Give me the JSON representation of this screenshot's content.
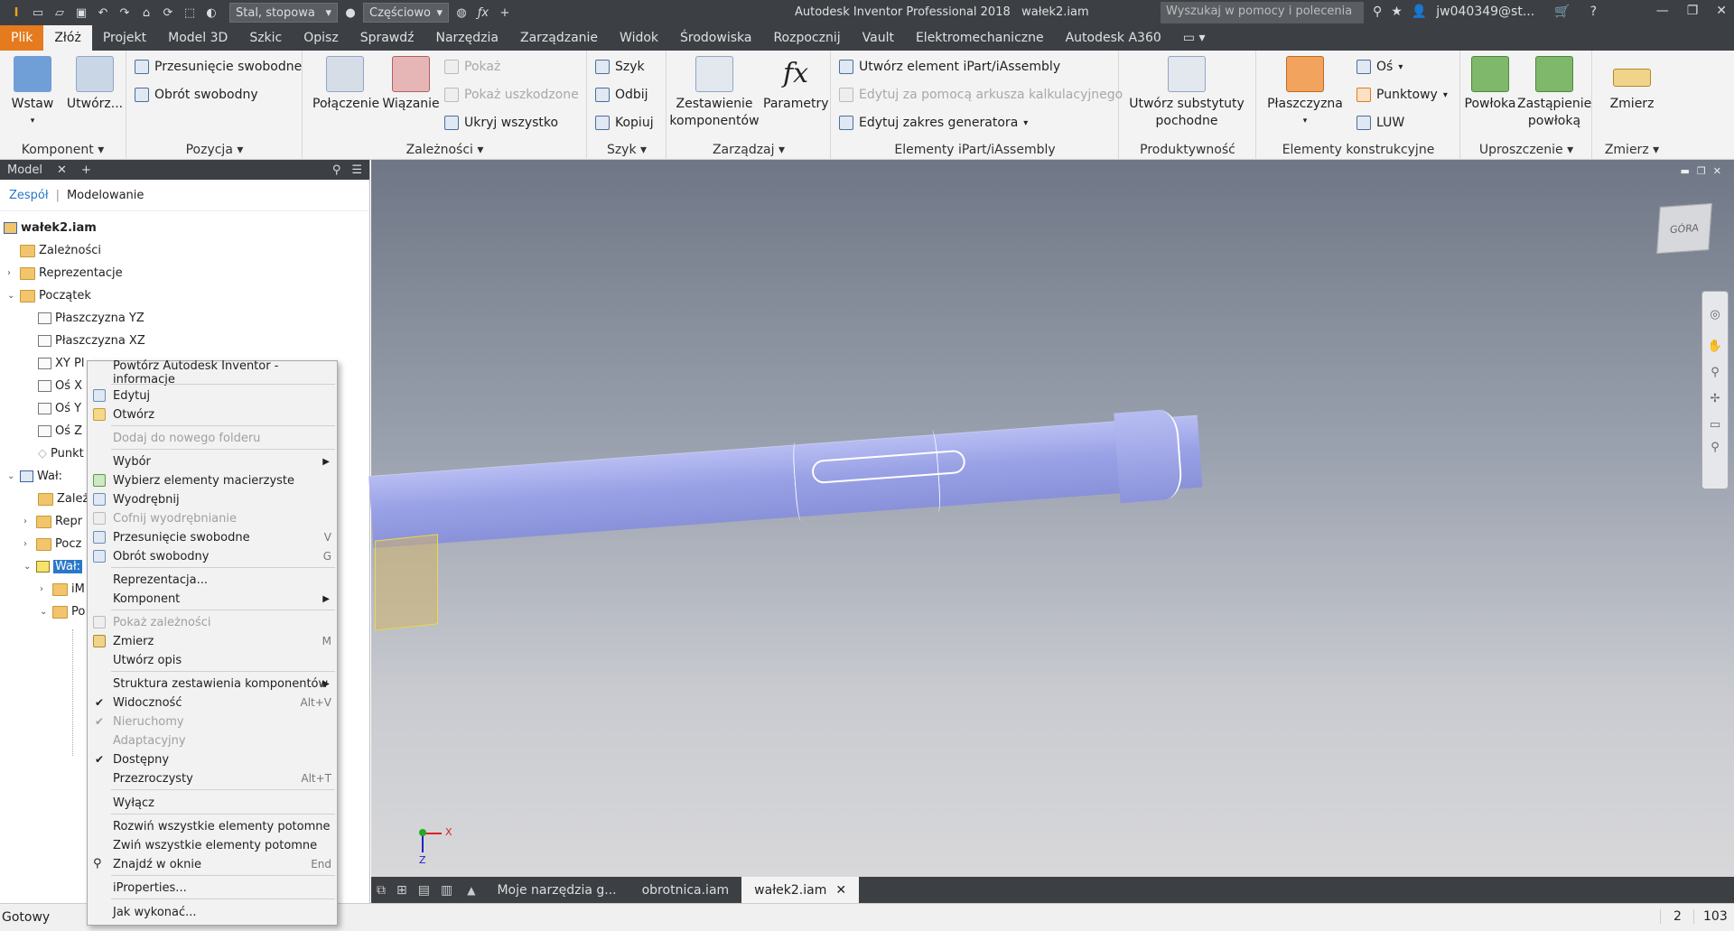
{
  "titlebar": {
    "material": "Stal, stopowa",
    "appearance": "Częściowo",
    "app_title": "Autodesk Inventor Professional 2018",
    "doc_title": "wałek2.iam",
    "search_placeholder": "Wyszukaj w pomocy i polecenia",
    "user": "jw040349@st..."
  },
  "menu": {
    "tabs": [
      "Plik",
      "Złóż",
      "Projekt",
      "Model 3D",
      "Szkic",
      "Opisz",
      "Sprawdź",
      "Narzędzia",
      "Zarządzanie",
      "Widok",
      "Środowiska",
      "Rozpocznij",
      "Vault",
      "Elektromechaniczne",
      "Autodesk A360"
    ]
  },
  "ribbon": {
    "komponent": {
      "title": "Komponent",
      "wstaw": "Wstaw",
      "utworz": "Utwórz..."
    },
    "pozycja": {
      "title": "Pozycja",
      "przesuniecie": "Przesunięcie swobodne",
      "obrot": "Obrót swobodny"
    },
    "zaleznosci": {
      "title": "Zależności",
      "polaczenie": "Połączenie",
      "wiazanie": "Wiązanie",
      "pokaz": "Pokaż",
      "pokaz_uszk": "Pokaż uszkodzone",
      "ukryj": "Ukryj wszystko"
    },
    "szyk": {
      "title": "Szyk",
      "szyk": "Szyk",
      "odbij": "Odbij",
      "kopiuj": "Kopiuj"
    },
    "zarzadzaj": {
      "title": "Zarządzaj",
      "zestawienie": "Zestawienie komponentów",
      "parametry": "Parametry"
    },
    "ipart": {
      "title": "Elementy iPart/iAssembly",
      "utworz": "Utwórz element iPart/iAssembly",
      "edytuj": "Edytuj za pomocą arkusza kalkulacyjnego",
      "zakres": "Edytuj zakres generatora"
    },
    "produktywnosc": {
      "title": "Produktywność",
      "substytut": "Utwórz substytuty pochodne"
    },
    "konstrukcyjne": {
      "title": "Elementy konstrukcyjne",
      "plaszczyzna": "Płaszczyzna",
      "os": "Oś",
      "punktowy": "Punktowy",
      "luw": "LUW"
    },
    "uproszczenie": {
      "title": "Uproszczenie",
      "powloka": "Powłoka",
      "zastapienie": "Zastąpienie powłoką"
    },
    "zmierz": {
      "title": "Zmierz",
      "zmierz": "Zmierz"
    }
  },
  "browser": {
    "header": "Model",
    "sub_tab1": "Zespół",
    "sub_tab2": "Modelowanie",
    "nodes": [
      "wałek2.iam",
      "Zależności",
      "Reprezentacje",
      "Początek",
      "Płaszczyzna YZ",
      "Płaszczyzna XZ",
      "XY Pl",
      "Oś X",
      "Oś Y",
      "Oś Z",
      "Punkt",
      "Wał:",
      "Zależ",
      "Repr",
      "Pocz",
      "Wał:",
      "iM",
      "Po"
    ]
  },
  "context_menu": {
    "items": [
      {
        "label": "Powtórz Autodesk Inventor - informacje"
      },
      {
        "label": "Edytuj"
      },
      {
        "label": "Otwórz"
      },
      {
        "label": "Dodaj do nowego folderu"
      },
      {
        "label": "Wybór"
      },
      {
        "label": "Wybierz elementy macierzyste"
      },
      {
        "label": "Wyodrębnij"
      },
      {
        "label": "Cofnij wyodrębnianie"
      },
      {
        "label": "Przesunięcie swobodne",
        "shortcut": "V"
      },
      {
        "label": "Obrót swobodny",
        "shortcut": "G"
      },
      {
        "label": "Reprezentacja..."
      },
      {
        "label": "Komponent"
      },
      {
        "label": "Pokaż zależności"
      },
      {
        "label": "Zmierz",
        "shortcut": "M"
      },
      {
        "label": "Utwórz opis"
      },
      {
        "label": "Struktura zestawienia komponentów"
      },
      {
        "label": "Widoczność",
        "shortcut": "Alt+V"
      },
      {
        "label": "Nieruchomy"
      },
      {
        "label": "Adaptacyjny"
      },
      {
        "label": "Dostępny"
      },
      {
        "label": "Przezroczysty",
        "shortcut": "Alt+T"
      },
      {
        "label": "Wyłącz"
      },
      {
        "label": "Rozwiń wszystkie elementy potomne"
      },
      {
        "label": "Zwiń wszystkie elementy potomne"
      },
      {
        "label": "Znajdź w oknie",
        "shortcut": "End"
      },
      {
        "label": "iProperties..."
      },
      {
        "label": "Jak wykonać..."
      }
    ]
  },
  "viewport": {
    "viewcube_label": "GÓRA",
    "axis_x": "X",
    "axis_z": "Z"
  },
  "doc_tabs": [
    "Moje narzędzia g...",
    "obrotnica.iam",
    "wałek2.iam"
  ],
  "status": {
    "text": "Gotowy",
    "count1": "2",
    "count2": "103"
  }
}
